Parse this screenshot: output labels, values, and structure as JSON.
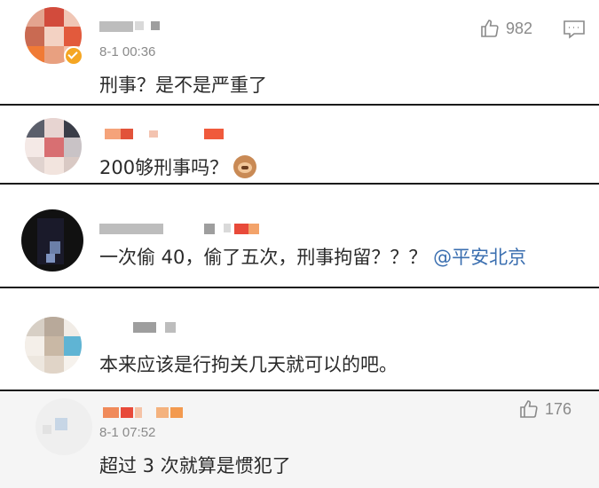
{
  "comments": [
    {
      "time": "8-1 00:36",
      "text": "刑事？是不是严重了",
      "likes": "982",
      "verified": true,
      "like_icon": "thumbs-up-icon",
      "comment_icon": "comment-icon"
    },
    {
      "text": "200够刑事吗？",
      "emoji": "monkey-see-no-evil-emoji"
    },
    {
      "text_before_mention": "一次偷 40，偷了五次，刑事拘留？？？",
      "mention": "@平安北京"
    },
    {
      "text": "本来应该是行拘关几天就可以的吧。"
    },
    {
      "time": "8-1 07:52",
      "text": "超过 3 次就算是惯犯了",
      "likes": "176",
      "like_icon": "thumbs-up-icon"
    }
  ],
  "colors": {
    "background": "#ffffff",
    "last_block_background": "#f5f5f5",
    "separator": "#1a1a1a",
    "mention": "#3b6fb0",
    "meta_gray": "#8a8a8a",
    "verified_badge": "#f5a623"
  }
}
